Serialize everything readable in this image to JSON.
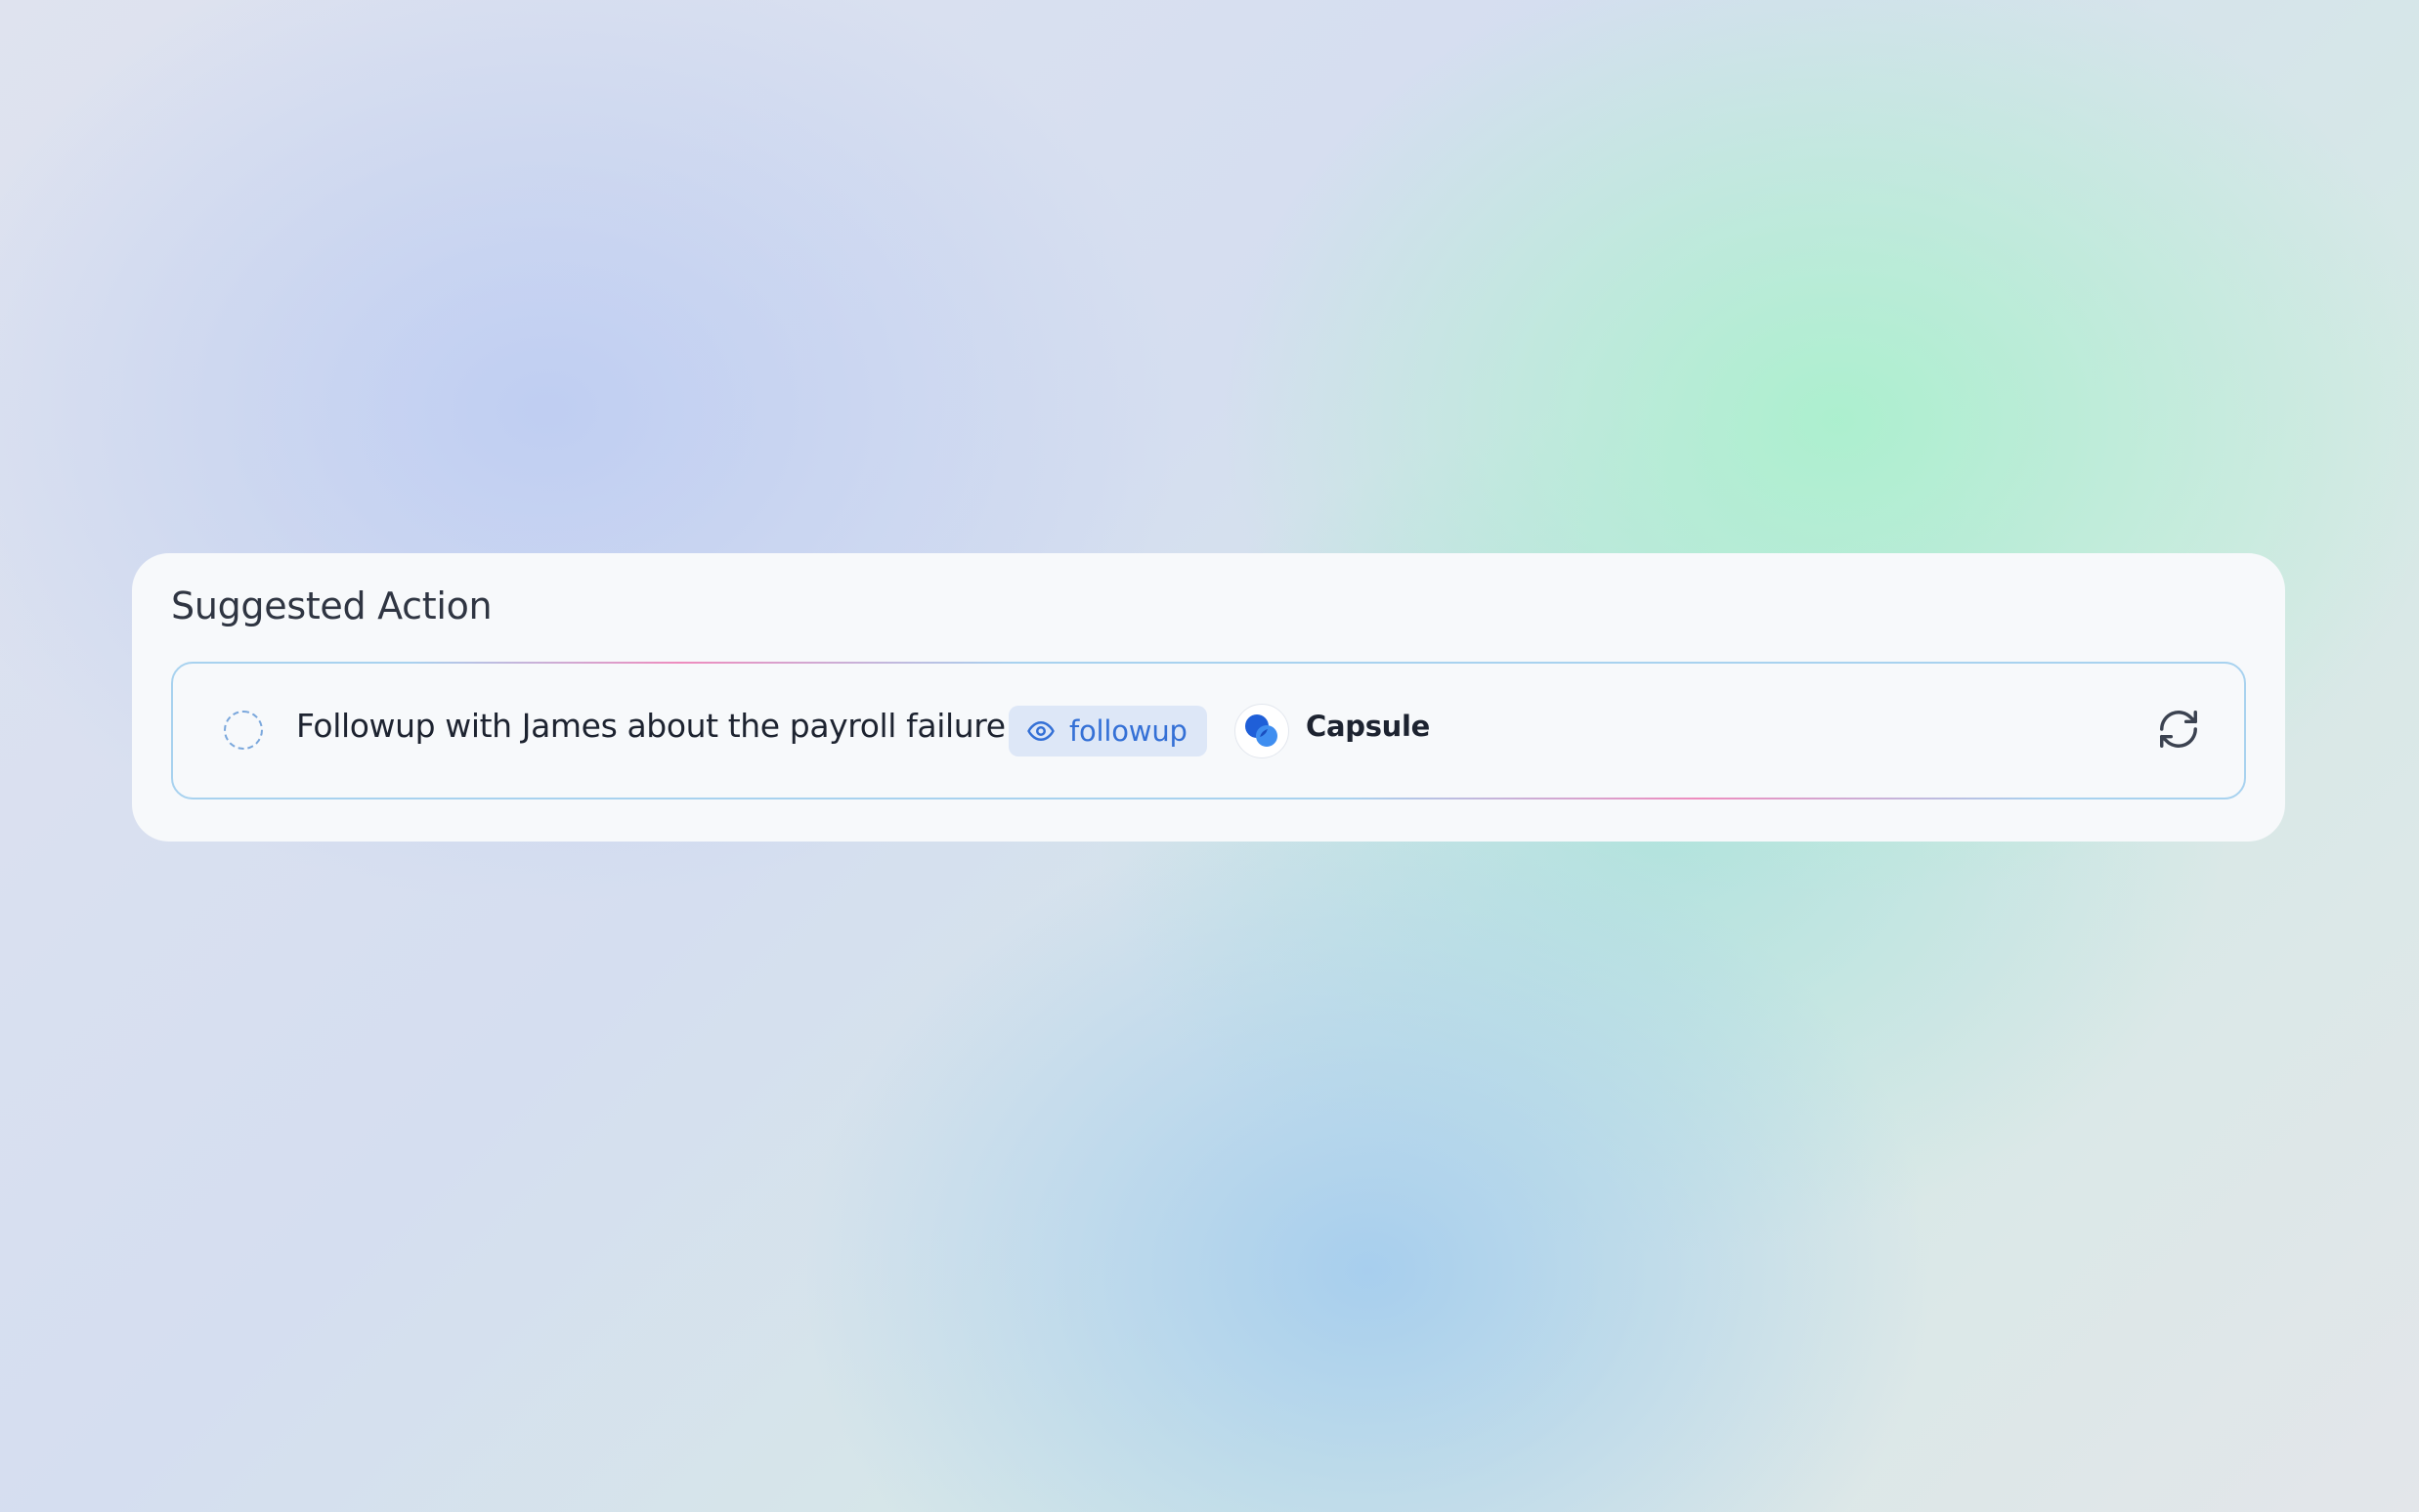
{
  "card": {
    "title": "Suggested Action"
  },
  "action": {
    "text": "Followup with James about the payroll failure",
    "tag": {
      "icon": "eye-icon",
      "label": "followup"
    },
    "app": {
      "icon": "capsule-logo",
      "name": "Capsule"
    },
    "refresh_icon": "refresh-icon"
  },
  "colors": {
    "tag_text": "#3470d6",
    "tag_bg": "#dde7f7",
    "row_border": "#a8d2ef",
    "accent": "#ee8cbe"
  }
}
